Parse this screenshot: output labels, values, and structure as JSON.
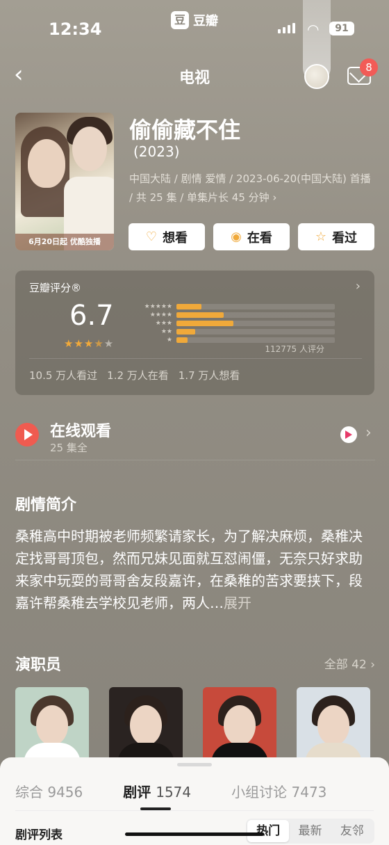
{
  "status_bar": {
    "time": "12:34",
    "battery": "91",
    "app_brand_box": "豆",
    "app_brand_text": "豆瓣"
  },
  "header": {
    "title": "电视",
    "notification_count": "8"
  },
  "movie": {
    "poster_caption": "6月20日起 优酷独播",
    "title": "偷偷藏不住",
    "year": "(2023)",
    "meta": "中国大陆 / 剧情 爱情 / 2023-06-20(中国大陆) 首播 / 共 25 集 / 单集片长 45 分钟 ›",
    "actions": [
      {
        "label": "想看",
        "icon": "heart-plus-icon"
      },
      {
        "label": "在看",
        "icon": "target-icon"
      },
      {
        "label": "看过",
        "icon": "star-outline-icon"
      }
    ]
  },
  "rating": {
    "label": "豆瓣评分®",
    "score": "6.7",
    "stars_filled": "★★★",
    "stars_half": "★",
    "stars_empty": "★",
    "distribution": [
      {
        "stars": "★★★★★",
        "fraction": 0.16
      },
      {
        "stars": "★★★★",
        "fraction": 0.3
      },
      {
        "stars": "★★★",
        "fraction": 0.36
      },
      {
        "stars": "★★",
        "fraction": 0.12
      },
      {
        "stars": "★",
        "fraction": 0.07
      }
    ],
    "count": "112775 人评分",
    "stats": [
      "10.5 万人看过",
      "1.2 万人在看",
      "1.7 万人想看"
    ]
  },
  "watch": {
    "title": "在线观看",
    "subtitle": "25 集全"
  },
  "synopsis": {
    "title": "剧情简介",
    "text": "桑稚高中时期被老师频繁请家长，为了解决麻烦，桑稚决定找哥哥顶包，然而兄妹见面就互怼闹僵，无奈只好求助来家中玩耍的哥哥舍友段嘉许，在桑稚的苦求要挟下，段嘉许帮桑稚去学校见老师，两人…",
    "more": "展开"
  },
  "cast": {
    "title": "演职员",
    "all_label": "全部 42 ›"
  },
  "sheet": {
    "tabs": [
      {
        "label": "综合",
        "count": "9456"
      },
      {
        "label": "剧评",
        "count": "1574"
      },
      {
        "label": "小组讨论",
        "count": "7473"
      }
    ],
    "list_label": "剧评列表",
    "sort_options": [
      "热门",
      "最新",
      "友邻"
    ]
  },
  "colors": {
    "accent": "#f0a93a",
    "play_red": "#ef5b50",
    "badge_red": "#f25b57"
  }
}
